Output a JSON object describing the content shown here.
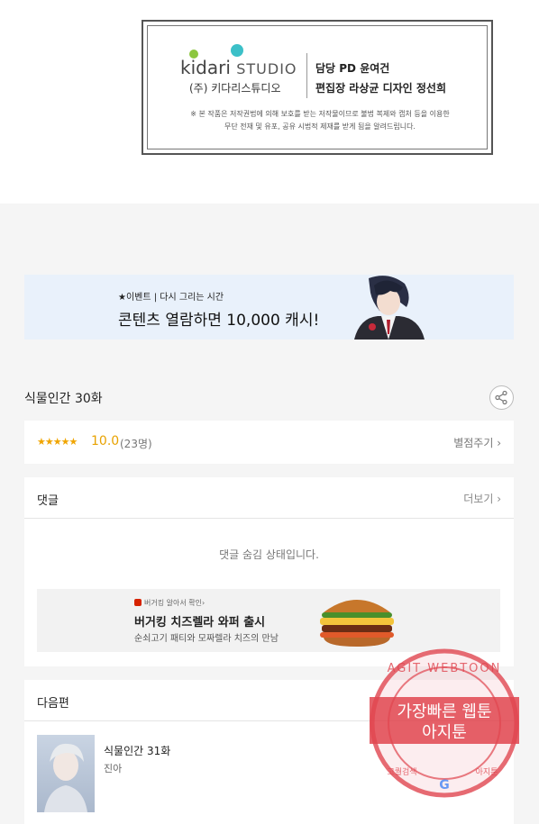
{
  "credits": {
    "logo_brand": "kidari",
    "logo_studio": "STUDIO",
    "logo_korean": "(주) 키다리스튜디오",
    "line1": "담당 PD  윤여건",
    "line2": "편집장  라상균   디자인  정선희",
    "notice1": "※ 본 작품은 저작권법에 의해 보호를 받는 저작물이므로 불법 복제와 캡처 등을 이용한",
    "notice2": "무단 전재 및 유포, 공유 시법적 제재를 받게 됨을 알려드립니다."
  },
  "banner": {
    "small": "★이벤트 | 다시 그리는 시간",
    "big": "콘텐츠 열람하면 10,000 캐시!"
  },
  "episode": {
    "title": "식물인간 30화",
    "stars": "★★★★★",
    "score": "10.0",
    "votes": "(23명)",
    "rate_link": "별점주기 ›"
  },
  "comments": {
    "heading": "댓글",
    "more": "더보기 ›",
    "hidden_message": "댓글 숨김 상태입니다."
  },
  "ad": {
    "tag": "버거킹 알아서 확인›",
    "title": "버거킹 치즈렐라 와퍼 출시",
    "desc": "순쇠고기 패티와 모짜렐라 치즈의 만남"
  },
  "next": {
    "heading": "다음편",
    "title": "식물인간 31화",
    "author": "진아"
  },
  "stamp": {
    "top_arc": "AGIT WEBTOON",
    "line1": "가장빠른 웹툰",
    "line2": "아지툰",
    "bottom_left": "고퀄검색",
    "bottom_right": "아지툰"
  },
  "colors": {
    "accent_star": "#f0a500",
    "banner_bg": "#e9f1fb",
    "stamp_red": "#e0454f"
  }
}
